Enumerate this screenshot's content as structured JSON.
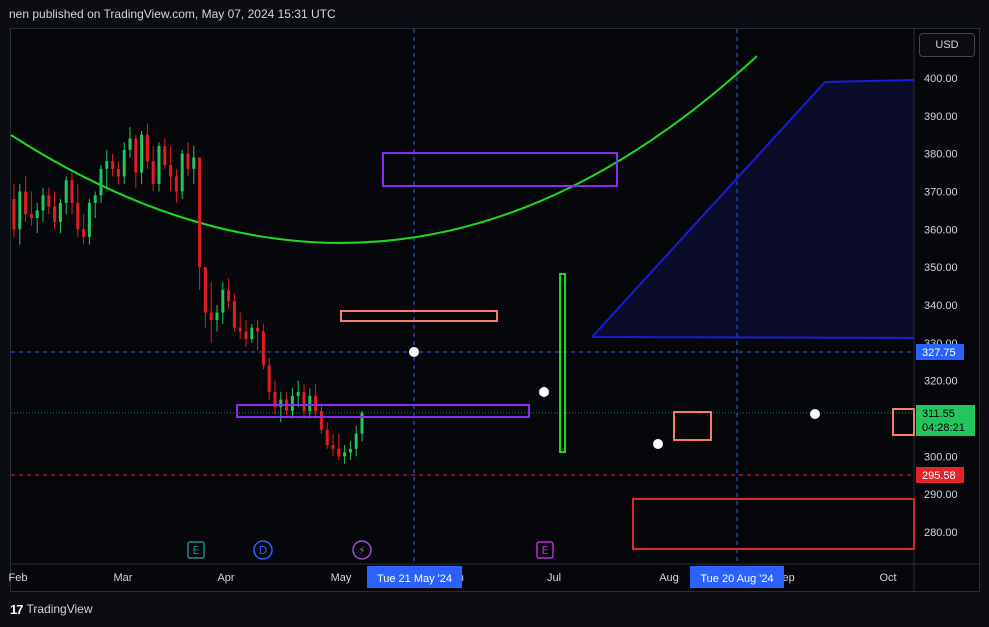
{
  "header": {
    "published": "nen published on TradingView.com, May 07, 2024 15:31 UTC"
  },
  "footer": {
    "brand": "TradingView"
  },
  "toolbar": {
    "currency": "USD"
  },
  "colors": {
    "up": "#22c55e",
    "down": "#e11d24",
    "accent_blue": "#2962ff",
    "curve": "#1ed91e",
    "purple": "#8b2cf5",
    "salmon": "#f77b72",
    "red_box": "#e3242b"
  },
  "chart_data": {
    "type": "candlestick",
    "symbol_currency": "USD",
    "ylim": [
      270,
      404
    ],
    "y_ticks": [
      "400.00",
      "390.00",
      "380.00",
      "370.00",
      "360.00",
      "350.00",
      "340.00",
      "330.00",
      "320.00",
      "310.00",
      "300.00",
      "290.00",
      "280.00"
    ],
    "x_ticks": [
      "Feb",
      "Mar",
      "Apr",
      "May",
      "Jun",
      "Jul",
      "Aug",
      "Sep",
      "Oct"
    ],
    "price_labels": [
      {
        "value": "327.75",
        "color": "#2962ff"
      },
      {
        "value": "311.55",
        "sub": "04:28:21",
        "color": "#22c55e"
      },
      {
        "value": "295.58",
        "color": "#e3242b"
      }
    ],
    "crosshair_labels": [
      "Tue 21 May '24",
      "Tue 20 Aug '24"
    ],
    "events": [
      {
        "label": "E",
        "kind": "earnings"
      },
      {
        "label": "D",
        "kind": "dividend"
      },
      {
        "label": "⚡",
        "kind": "split"
      },
      {
        "label": "E",
        "kind": "earnings"
      }
    ],
    "candles": [
      [
        368,
        372,
        358,
        360
      ],
      [
        360,
        372,
        356,
        370
      ],
      [
        370,
        374,
        362,
        364
      ],
      [
        364,
        370,
        361,
        363
      ],
      [
        363,
        367,
        359,
        365
      ],
      [
        365,
        371,
        362,
        369
      ],
      [
        369,
        371,
        364,
        366
      ],
      [
        366,
        370,
        360,
        362
      ],
      [
        362,
        368,
        359,
        367
      ],
      [
        367,
        374,
        364,
        373
      ],
      [
        373,
        375,
        364,
        367
      ],
      [
        367,
        372,
        358,
        360
      ],
      [
        360,
        364,
        356,
        358
      ],
      [
        358,
        368,
        356,
        367
      ],
      [
        367,
        370,
        363,
        369
      ],
      [
        369,
        377,
        367,
        376
      ],
      [
        376,
        381,
        371,
        378
      ],
      [
        378,
        380,
        374,
        376
      ],
      [
        376,
        378,
        372,
        374
      ],
      [
        374,
        383,
        372,
        381
      ],
      [
        381,
        387,
        379,
        384
      ],
      [
        384,
        385,
        371,
        375
      ],
      [
        375,
        386,
        372,
        385
      ],
      [
        385,
        388,
        376,
        378
      ],
      [
        378,
        382,
        370,
        372
      ],
      [
        372,
        383,
        370,
        382
      ],
      [
        382,
        384,
        376,
        377
      ],
      [
        377,
        382,
        370,
        374
      ],
      [
        374,
        376,
        367,
        370
      ],
      [
        370,
        381,
        368,
        380
      ],
      [
        380,
        383,
        374,
        376
      ],
      [
        376,
        382,
        372,
        379
      ],
      [
        379,
        370,
        344,
        350
      ],
      [
        350,
        349,
        334,
        338
      ],
      [
        338,
        346,
        330,
        336
      ],
      [
        336,
        340,
        333,
        338
      ],
      [
        338,
        346,
        335,
        344
      ],
      [
        344,
        347,
        339,
        341
      ],
      [
        341,
        343,
        333,
        334
      ],
      [
        334,
        338,
        331,
        333
      ],
      [
        333,
        336,
        329,
        331
      ],
      [
        331,
        335,
        330,
        334
      ],
      [
        334,
        336,
        328,
        333
      ],
      [
        333,
        335,
        323,
        324
      ],
      [
        324,
        326,
        315,
        317
      ],
      [
        317,
        320,
        311,
        313
      ],
      [
        313,
        317,
        309,
        315
      ],
      [
        315,
        317,
        311,
        312
      ],
      [
        312,
        318,
        310,
        316
      ],
      [
        316,
        320,
        313,
        317
      ],
      [
        317,
        319,
        310,
        312
      ],
      [
        312,
        318,
        310,
        316
      ],
      [
        316,
        319,
        310,
        312
      ],
      [
        312,
        314,
        306,
        307
      ],
      [
        307,
        309,
        302,
        303
      ],
      [
        303,
        306,
        300,
        302
      ],
      [
        302,
        306,
        299,
        300
      ],
      [
        300,
        303,
        298,
        301
      ],
      [
        301,
        304,
        299,
        302
      ],
      [
        302,
        308,
        300,
        306
      ],
      [
        306,
        312,
        304,
        311.55
      ]
    ],
    "drawings": [
      "purple-rectangle-upper",
      "purple-rectangle-lower",
      "salmon-rectangle-upper",
      "salmon-rectangle-aug",
      "salmon-rectangle-oct",
      "red-rectangle",
      "green-vertical-rectangle",
      "blue-triangle",
      "green-arc-curve"
    ]
  }
}
